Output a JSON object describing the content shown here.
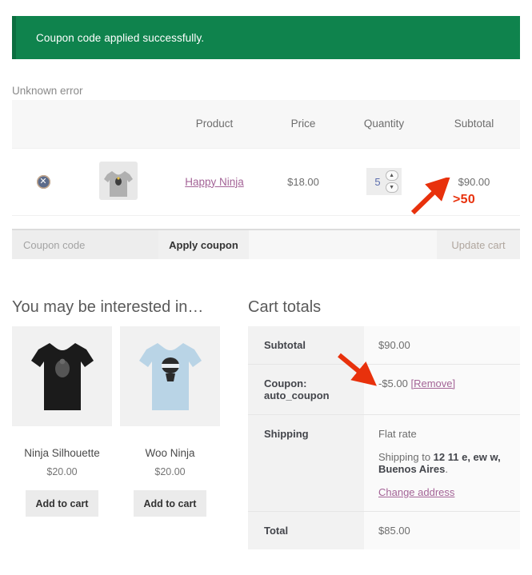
{
  "notice": {
    "message": "Coupon code applied successfully."
  },
  "error": {
    "message": "Unknown error"
  },
  "colors": {
    "notice_green": "#0f834d",
    "annotation_red": "#e8310c",
    "link_mauve": "#a46497"
  },
  "cart_table": {
    "columns": [
      "",
      "",
      "Product",
      "Price",
      "Quantity",
      "Subtotal"
    ],
    "rows": [
      {
        "remove_icon": "remove-circle-icon",
        "thumbnail": "tshirt-grey-thumbnail",
        "product": "Happy Ninja",
        "price": "$18.00",
        "quantity": "5",
        "subtotal": "$90.00"
      }
    ]
  },
  "annotations": [
    {
      "label": ">50",
      "target": "subtotal-value"
    },
    {
      "label": "",
      "target": "coupon-discount-value"
    }
  ],
  "coupon": {
    "placeholder": "Coupon code",
    "value": "",
    "apply_label": "Apply coupon",
    "update_label": "Update cart"
  },
  "related": {
    "heading": "You may be interested in…",
    "products": [
      {
        "name": "Ninja Silhouette",
        "price": "$20.00",
        "add_label": "Add to cart",
        "shirt_color": "#1b1b1b",
        "art_color": "#555555"
      },
      {
        "name": "Woo Ninja",
        "price": "$20.00",
        "add_label": "Add to cart",
        "shirt_color": "#b9d4e6",
        "art_color": "#2b2b2b"
      }
    ]
  },
  "cart_totals": {
    "heading": "Cart totals",
    "rows": {
      "subtotal_label": "Subtotal",
      "subtotal_value": "$90.00",
      "coupon_label": "Coupon: auto_coupon",
      "coupon_value": "-$5.00",
      "coupon_remove": "[Remove]",
      "shipping_label": "Shipping",
      "shipping_method": "Flat rate",
      "shipping_to_prefix": "Shipping to ",
      "shipping_address": "12 11 e, ew w, Buenos Aires",
      "shipping_to_suffix": ".",
      "change_address": "Change address",
      "total_label": "Total",
      "total_value": "$85.00"
    }
  }
}
